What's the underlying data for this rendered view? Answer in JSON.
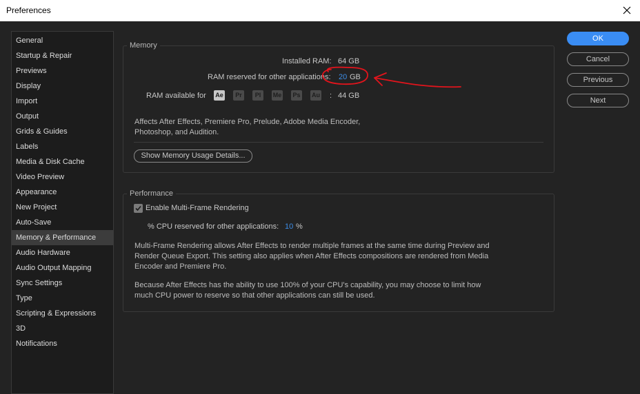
{
  "window": {
    "title": "Preferences"
  },
  "sidebar": {
    "items": [
      {
        "label": "General"
      },
      {
        "label": "Startup & Repair"
      },
      {
        "label": "Previews"
      },
      {
        "label": "Display"
      },
      {
        "label": "Import"
      },
      {
        "label": "Output"
      },
      {
        "label": "Grids & Guides"
      },
      {
        "label": "Labels"
      },
      {
        "label": "Media & Disk Cache"
      },
      {
        "label": "Video Preview"
      },
      {
        "label": "Appearance"
      },
      {
        "label": "New Project"
      },
      {
        "label": "Auto-Save"
      },
      {
        "label": "Memory & Performance",
        "selected": true
      },
      {
        "label": "Audio Hardware"
      },
      {
        "label": "Audio Output Mapping"
      },
      {
        "label": "Sync Settings"
      },
      {
        "label": "Type"
      },
      {
        "label": "Scripting & Expressions"
      },
      {
        "label": "3D"
      },
      {
        "label": "Notifications"
      }
    ]
  },
  "buttons": {
    "ok": "OK",
    "cancel": "Cancel",
    "previous": "Previous",
    "next": "Next"
  },
  "memory": {
    "title": "Memory",
    "installed_label": "Installed RAM:",
    "installed_value": "64 GB",
    "reserved_label": "RAM reserved for other applications:",
    "reserved_value": "20",
    "reserved_unit": "GB",
    "available_label": "RAM available for",
    "apps": [
      "Ae",
      "Pr",
      "Pl",
      "Me",
      "Ps",
      "Au"
    ],
    "available_colon": ":",
    "available_value": "44 GB",
    "affects_line1": "Affects After Effects, Premiere Pro, Prelude, Adobe Media Encoder,",
    "affects_line2": "Photoshop, and Audition.",
    "show_details_button": "Show Memory Usage Details..."
  },
  "performance": {
    "title": "Performance",
    "mfr_checkbox_label": "Enable Multi-Frame Rendering",
    "mfr_checked": true,
    "cpu_label": "% CPU reserved for other applications:",
    "cpu_value": "10",
    "cpu_unit": "%",
    "desc1_line1": "Multi-Frame Rendering allows After Effects to render multiple frames at the same time during Preview and",
    "desc1_line2": "Render Queue Export. This setting also applies when After Effects compositions are rendered from Media",
    "desc1_line3": "Encoder and Premiere Pro.",
    "desc2_line1": "Because After Effects has the ability to use 100% of your CPU's capability, you may choose to limit how",
    "desc2_line2": "much CPU power to reserve so that other applications can still be used."
  },
  "colors": {
    "accent": "#3a8df4",
    "annotation": "#e3141c"
  }
}
